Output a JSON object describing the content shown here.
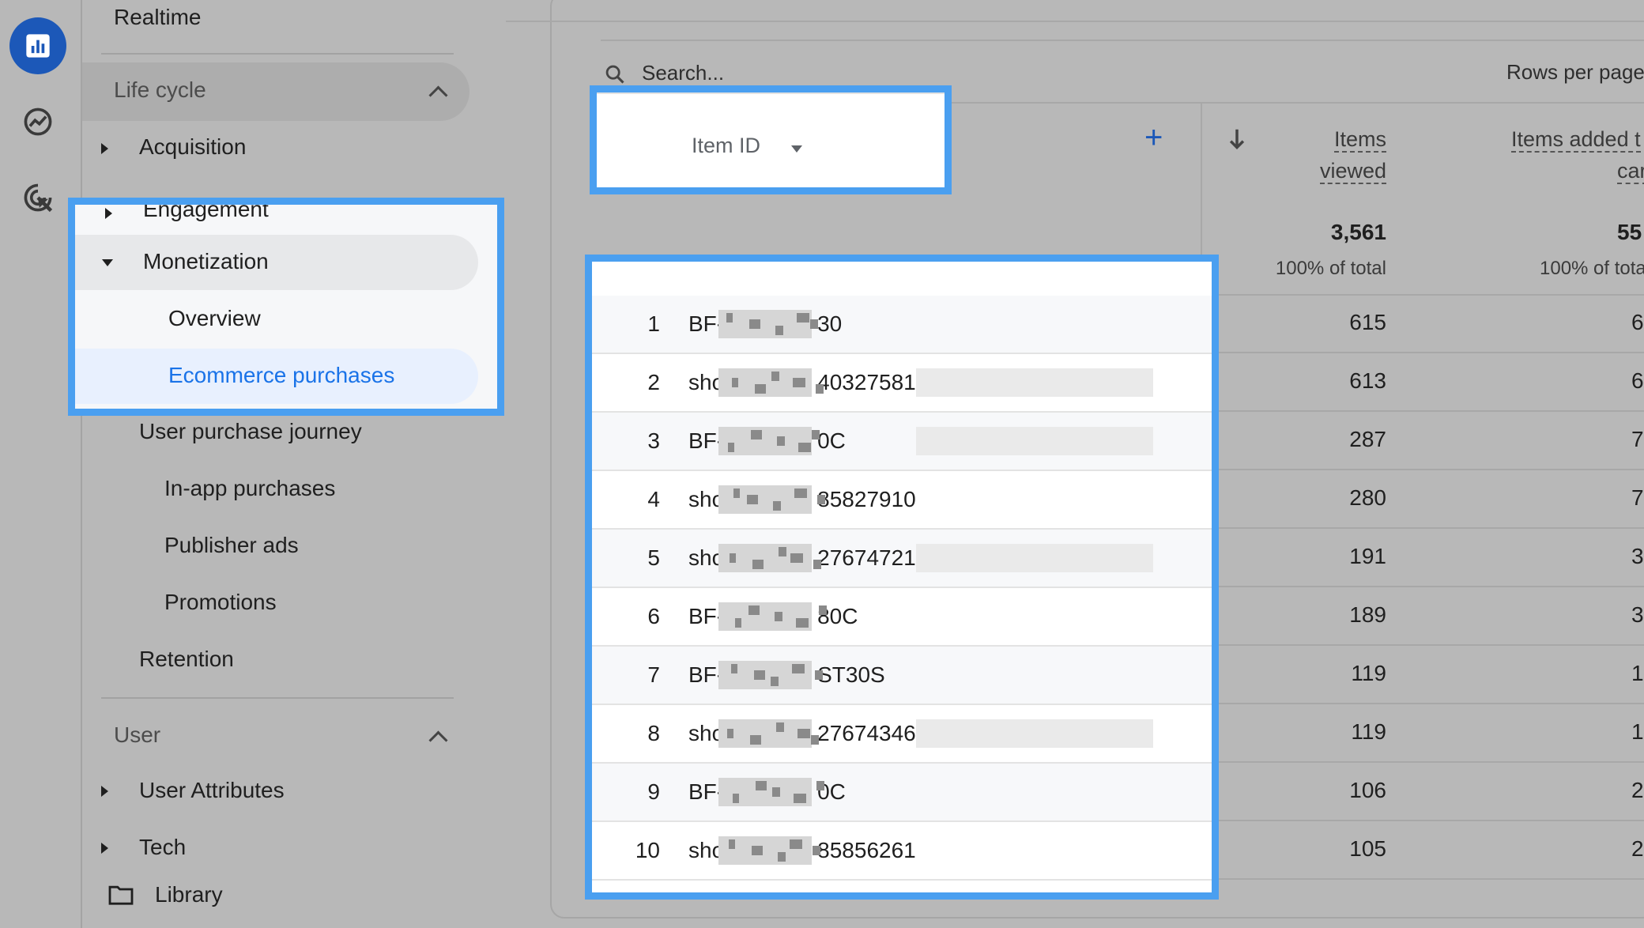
{
  "rail": {
    "icons": [
      "bar-chart-icon",
      "explore-icon",
      "advertising-icon"
    ]
  },
  "nav": {
    "realtime": "Realtime",
    "lifecycle_header": "Life cycle",
    "acquisition": "Acquisition",
    "engagement": "Engagement",
    "monetization": "Monetization",
    "overview": "Overview",
    "ecommerce": "Ecommerce purchases",
    "user_purchase_journey": "User purchase journey",
    "in_app": "In-app purchases",
    "publisher_ads": "Publisher ads",
    "promotions": "Promotions",
    "retention": "Retention",
    "user_header": "User",
    "user_attributes": "User Attributes",
    "tech": "Tech",
    "library": "Library"
  },
  "table": {
    "search_placeholder": "Search...",
    "rows_per_page": "Rows per page",
    "dimension": "Item ID",
    "add_label": "+",
    "col_items_viewed_1": "Items",
    "col_items_viewed_2": "viewed",
    "col_added_1": "Items added t",
    "col_added_2": "car",
    "total_viewed": "3,561",
    "total_added": "55",
    "pct_viewed": "100% of total",
    "pct_added": "100% of tota",
    "rows": [
      {
        "idx": "1",
        "id_a": "BF-",
        "id_b": "30",
        "viewed": "615",
        "added": "6"
      },
      {
        "idx": "2",
        "id_a": "sho",
        "id_b": "40327581",
        "viewed": "613",
        "added": "6"
      },
      {
        "idx": "3",
        "id_a": "BF-",
        "id_b": "0C",
        "viewed": "287",
        "added": "7"
      },
      {
        "idx": "4",
        "id_a": "sho",
        "id_b": "85827910",
        "viewed": "280",
        "added": "7"
      },
      {
        "idx": "5",
        "id_a": "sho",
        "id_b": "27674721",
        "viewed": "191",
        "added": "3"
      },
      {
        "idx": "6",
        "id_a": "BF-",
        "id_b": "80C",
        "viewed": "189",
        "added": "3"
      },
      {
        "idx": "7",
        "id_a": "BF-",
        "id_b": "ST30S",
        "viewed": "119",
        "added": "1"
      },
      {
        "idx": "8",
        "id_a": "sho",
        "id_b": "27674346",
        "viewed": "119",
        "added": "1"
      },
      {
        "idx": "9",
        "id_a": "BF-",
        "id_b": "0C",
        "viewed": "106",
        "added": "2"
      },
      {
        "idx": "10",
        "id_a": "sho",
        "id_b": "85856261",
        "viewed": "105",
        "added": "2"
      }
    ]
  },
  "colors": {
    "accent": "#1a73e8",
    "highlight": "#4a9ff0",
    "selected_bg": "#e8f0fe"
  }
}
